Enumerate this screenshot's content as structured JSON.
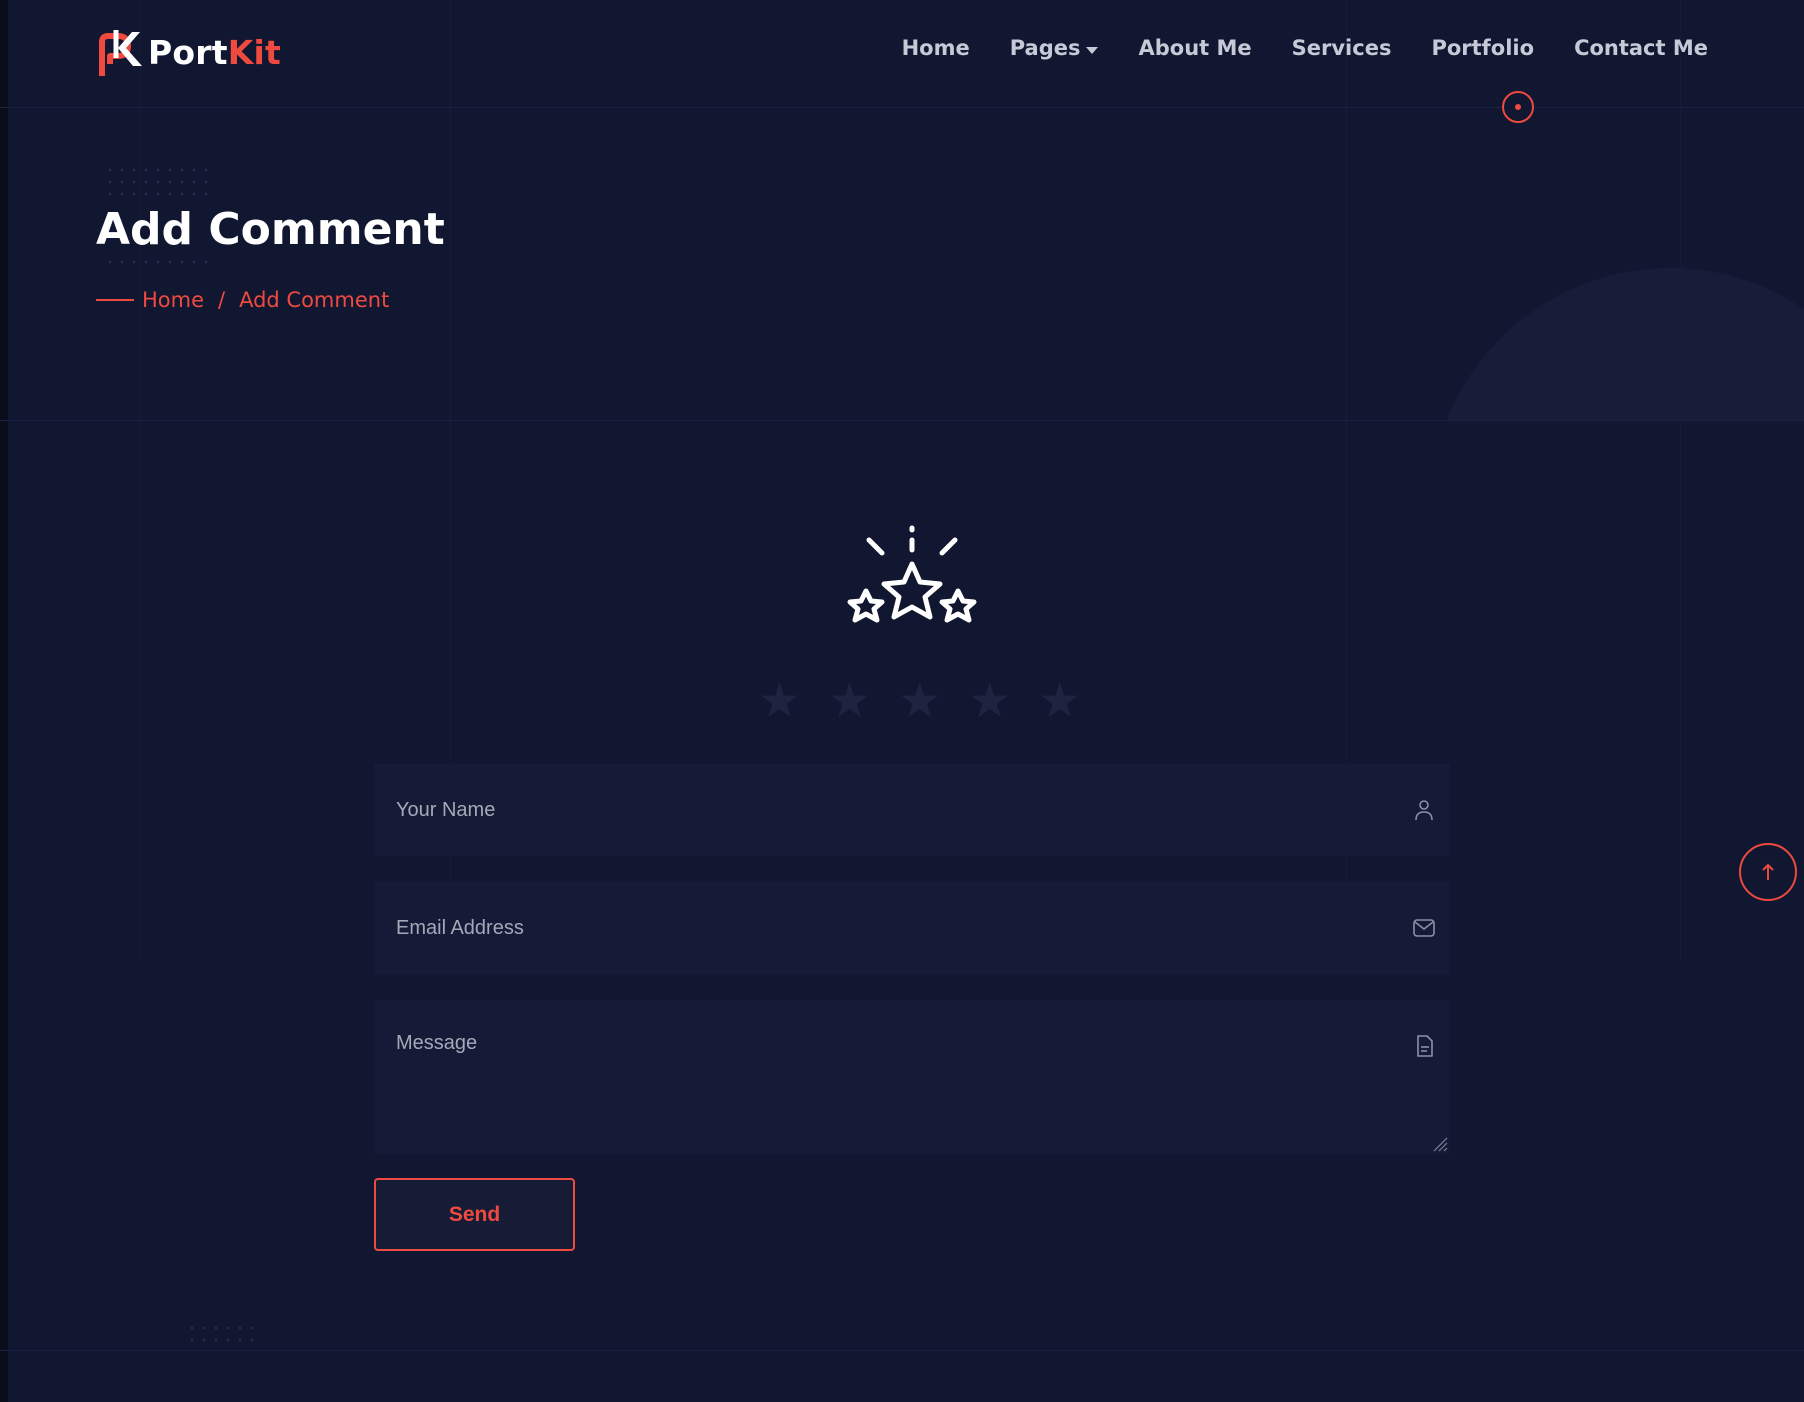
{
  "brand": {
    "name_main": "Port",
    "name_accent": "Kit",
    "accent_color": "#ee4a3f",
    "logo_icon": "pk-logo-icon"
  },
  "nav": {
    "items": [
      {
        "label": "Home"
      },
      {
        "label": "Pages",
        "has_dropdown": true
      },
      {
        "label": "About Me"
      },
      {
        "label": "Services"
      },
      {
        "label": "Portfolio"
      },
      {
        "label": "Contact Me"
      }
    ]
  },
  "hero": {
    "title": "Add Comment",
    "breadcrumb": {
      "home": "Home",
      "separator": "/",
      "current": "Add Comment"
    }
  },
  "rating": {
    "illustration_icon": "rating-stars-icon",
    "max_stars": 5,
    "selected": 0
  },
  "form": {
    "name_placeholder": "Your Name",
    "email_placeholder": "Email Address",
    "message_placeholder": "Message",
    "name_icon": "user-icon",
    "email_icon": "envelope-icon",
    "message_icon": "document-icon",
    "send_label": "Send"
  },
  "scroll_top": {
    "icon": "arrow-up-icon"
  },
  "colors": {
    "background": "#111731",
    "field_background": "#151b36",
    "accent": "#ee4a3f",
    "text_light": "#ffffff",
    "text_muted": "#c6c9d6"
  }
}
